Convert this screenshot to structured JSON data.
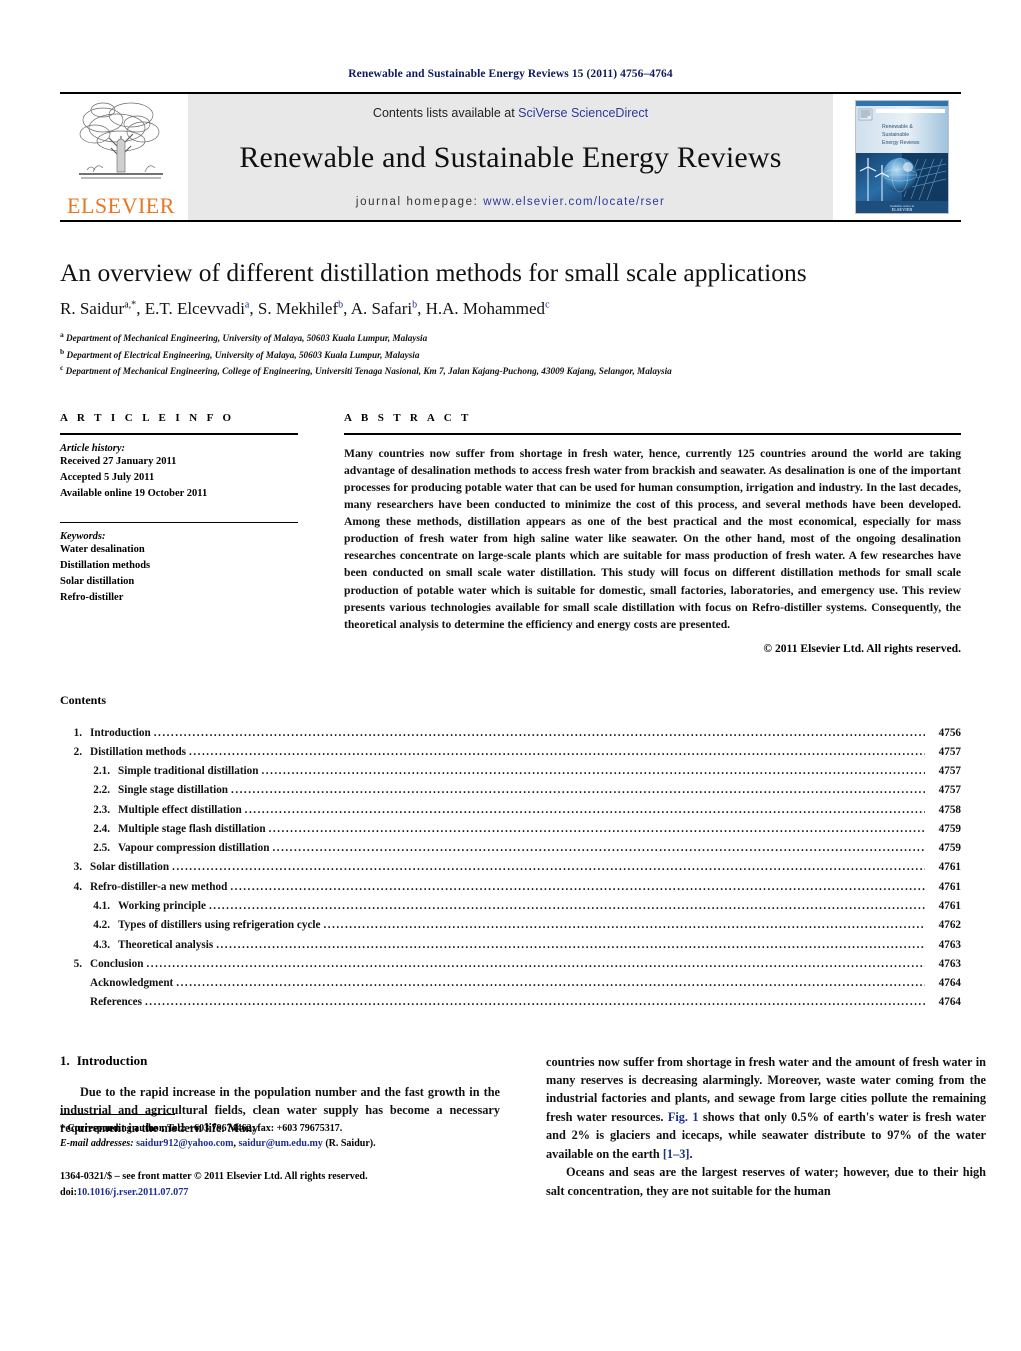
{
  "running_head": "Renewable and Sustainable Energy Reviews 15 (2011) 4756–4764",
  "masthead": {
    "publisher_wordmark": "ELSEVIER",
    "contents_prefix": "Contents lists available at ",
    "sciencedirect_link": "SciVerse ScienceDirect",
    "journal_title": "Renewable and Sustainable Energy Reviews",
    "homepage_prefix": "journal homepage: ",
    "homepage_link": "www.elsevier.com/locate/rser",
    "cover_title_lines": [
      "Renewable &",
      "Sustainable",
      "Energy Reviews"
    ],
    "cover_publisher": "ELSEVIER",
    "colors": {
      "link_blue": "#2b3a9c",
      "elsevier_orange": "#E87722",
      "banner_gray": "#e8e8e8",
      "runhead_navy": "#0f1a5e"
    }
  },
  "title": "An overview of different distillation methods for small scale applications",
  "authors": [
    {
      "name": "R. Saidur",
      "marks": "a,*"
    },
    {
      "name": "E.T. Elcevvadi",
      "marks": "a"
    },
    {
      "name": "S. Mekhilef",
      "marks": "b"
    },
    {
      "name": "A. Safari",
      "marks": "b"
    },
    {
      "name": "H.A. Mohammed",
      "marks": "c"
    }
  ],
  "affiliations": [
    {
      "mark": "a",
      "text": "Department of Mechanical Engineering, University of Malaya, 50603 Kuala Lumpur, Malaysia"
    },
    {
      "mark": "b",
      "text": "Department of Electrical Engineering, University of Malaya, 50603 Kuala Lumpur, Malaysia"
    },
    {
      "mark": "c",
      "text": "Department of Mechanical Engineering, College of Engineering, Universiti Tenaga Nasional, Km 7, Jalan Kajang-Puchong, 43009 Kajang, Selangor, Malaysia"
    }
  ],
  "article_info": {
    "heading": "A R T I C L E  I N F O",
    "history_label": "Article history:",
    "history": [
      "Received 27 January 2011",
      "Accepted 5 July 2011",
      "Available online 19 October 2011"
    ],
    "keywords_label": "Keywords:",
    "keywords": [
      "Water desalination",
      "Distillation methods",
      "Solar distillation",
      "Refro-distiller"
    ]
  },
  "abstract": {
    "heading": "A B S T R A C T",
    "text": "Many countries now suffer from shortage in fresh water, hence, currently 125 countries around the world are taking advantage of desalination methods to access fresh water from brackish and seawater. As desalination is one of the important processes for producing potable water that can be used for human consumption, irrigation and industry. In the last decades, many researchers have been conducted to minimize the cost of this process, and several methods have been developed. Among these methods, distillation appears as one of the best practical and the most economical, especially for mass production of fresh water from high saline water like seawater. On the other hand, most of the ongoing desalination researches concentrate on large-scale plants which are suitable for mass production of fresh water. A few researches have been conducted on small scale water distillation. This study will focus on different distillation methods for small scale production of potable water which is suitable for domestic, small factories, laboratories, and emergency use. This review presents various technologies available for small scale distillation with focus on Refro-distiller systems. Consequently, the theoretical analysis to determine the efficiency and energy costs are presented.",
    "copyright": "© 2011 Elsevier Ltd. All rights reserved."
  },
  "contents": {
    "heading": "Contents",
    "entries": [
      {
        "level": 1,
        "num": "1.",
        "label": "Introduction",
        "page": "4756"
      },
      {
        "level": 1,
        "num": "2.",
        "label": "Distillation methods",
        "page": "4757"
      },
      {
        "level": 2,
        "num": "2.1.",
        "label": "Simple traditional distillation",
        "page": "4757"
      },
      {
        "level": 2,
        "num": "2.2.",
        "label": "Single stage distillation",
        "page": "4757"
      },
      {
        "level": 2,
        "num": "2.3.",
        "label": "Multiple effect distillation",
        "page": "4758"
      },
      {
        "level": 2,
        "num": "2.4.",
        "label": "Multiple stage flash distillation",
        "page": "4759"
      },
      {
        "level": 2,
        "num": "2.5.",
        "label": "Vapour compression distillation",
        "page": "4759"
      },
      {
        "level": 1,
        "num": "3.",
        "label": "Solar distillation",
        "page": "4761"
      },
      {
        "level": 1,
        "num": "4.",
        "label": "Refro-distiller-a new method",
        "page": "4761"
      },
      {
        "level": 2,
        "num": "4.1.",
        "label": "Working principle",
        "page": "4761"
      },
      {
        "level": 2,
        "num": "4.2.",
        "label": "Types of distillers using refrigeration cycle",
        "page": "4762"
      },
      {
        "level": 2,
        "num": "4.3.",
        "label": "Theoretical analysis",
        "page": "4763"
      },
      {
        "level": 1,
        "num": "5.",
        "label": "Conclusion",
        "page": "4763"
      },
      {
        "level": 0,
        "num": "",
        "label": "Acknowledgment",
        "page": "4764"
      },
      {
        "level": 0,
        "num": "",
        "label": "References",
        "page": "4764"
      }
    ]
  },
  "introduction": {
    "number": "1.",
    "title": "Introduction",
    "left_para": "Due to the rapid increase in the population number and the fast growth in the industrial and agricultural fields, clean water supply has become a necessary requirement in the modern life. Many",
    "right_para_1a": "countries now suffer from shortage in fresh water and the amount of fresh water in many reserves is decreasing alarmingly. Moreover, waste water coming from the industrial factories and plants, and sewage from large cities pollute the remaining fresh water resources. ",
    "right_fig_link": "Fig. 1",
    "right_para_1b": " shows that only 0.5% of earth's water is fresh water and 2% is glaciers and icecaps, while seawater distribute to 97% of the water available on the earth ",
    "right_ref_link": "[1–3]",
    "right_para_1c": ".",
    "right_para_2": "Oceans and seas are the largest reserves of water; however, due to their high salt concentration, they are not suitable for the human"
  },
  "footnotes": {
    "corresponding": "* Corresponding author. Tel.: +603 79674462; fax: +603 79675317.",
    "email_label": "E-mail addresses:",
    "email_1": "saidur912@yahoo.com",
    "email_sep": ", ",
    "email_2": "saidur@um.edu.my",
    "email_suffix": " (R. Saidur).",
    "imprint_line1": "1364-0321/$ – see front matter © 2011 Elsevier Ltd. All rights reserved.",
    "doi_label": "doi:",
    "doi_value": "10.1016/j.rser.2011.07.077"
  }
}
